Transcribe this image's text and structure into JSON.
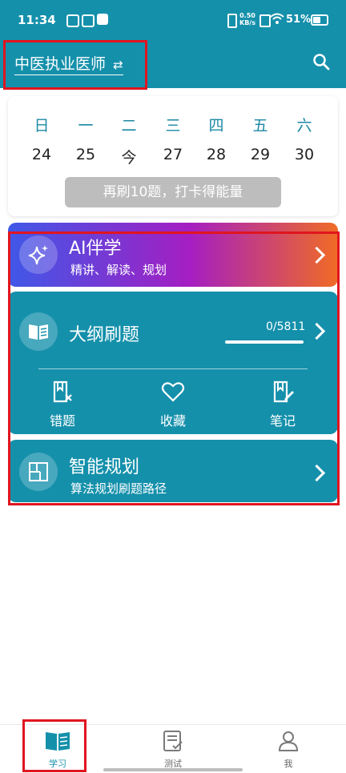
{
  "status": {
    "time": "11:34",
    "net_speed_value": "0.50",
    "net_speed_unit": "KB/s",
    "battery": "51%"
  },
  "appbar": {
    "title": "中医执业医师",
    "switch_icon": "swap-arrows-icon",
    "search_icon": "search-icon"
  },
  "calendar": {
    "weekdays": [
      "日",
      "一",
      "二",
      "三",
      "四",
      "五",
      "六"
    ],
    "dates": [
      "24",
      "25",
      "今",
      "27",
      "28",
      "29",
      "30"
    ],
    "checkin_button": "再刷10题，打卡得能量"
  },
  "ai_card": {
    "title": "AI伴学",
    "subtitle": "精讲、解读、规划",
    "icon": "sparkle-icon"
  },
  "outline_card": {
    "title": "大纲刷题",
    "progress_text": "0/5811",
    "progress_fraction": 0,
    "icon": "book-icon",
    "tools": [
      {
        "label": "错题",
        "icon": "wrong-questions-icon"
      },
      {
        "label": "收藏",
        "icon": "heart-icon"
      },
      {
        "label": "笔记",
        "icon": "notes-icon"
      }
    ]
  },
  "plan_card": {
    "title": "智能规划",
    "subtitle": "算法规划刷题路径",
    "icon": "floorplan-icon"
  },
  "bottom_nav": [
    {
      "label": "学习",
      "icon": "book-icon",
      "active": true
    },
    {
      "label": "测试",
      "icon": "exam-icon",
      "active": false
    },
    {
      "label": "我",
      "icon": "person-icon",
      "active": false
    }
  ],
  "colors": {
    "primary": "#1590ab",
    "highlight_box": "#e0151f",
    "ai_gradient_start": "#3f58e8",
    "ai_gradient_mid": "#a51ec2",
    "ai_gradient_end": "#f06b25"
  }
}
